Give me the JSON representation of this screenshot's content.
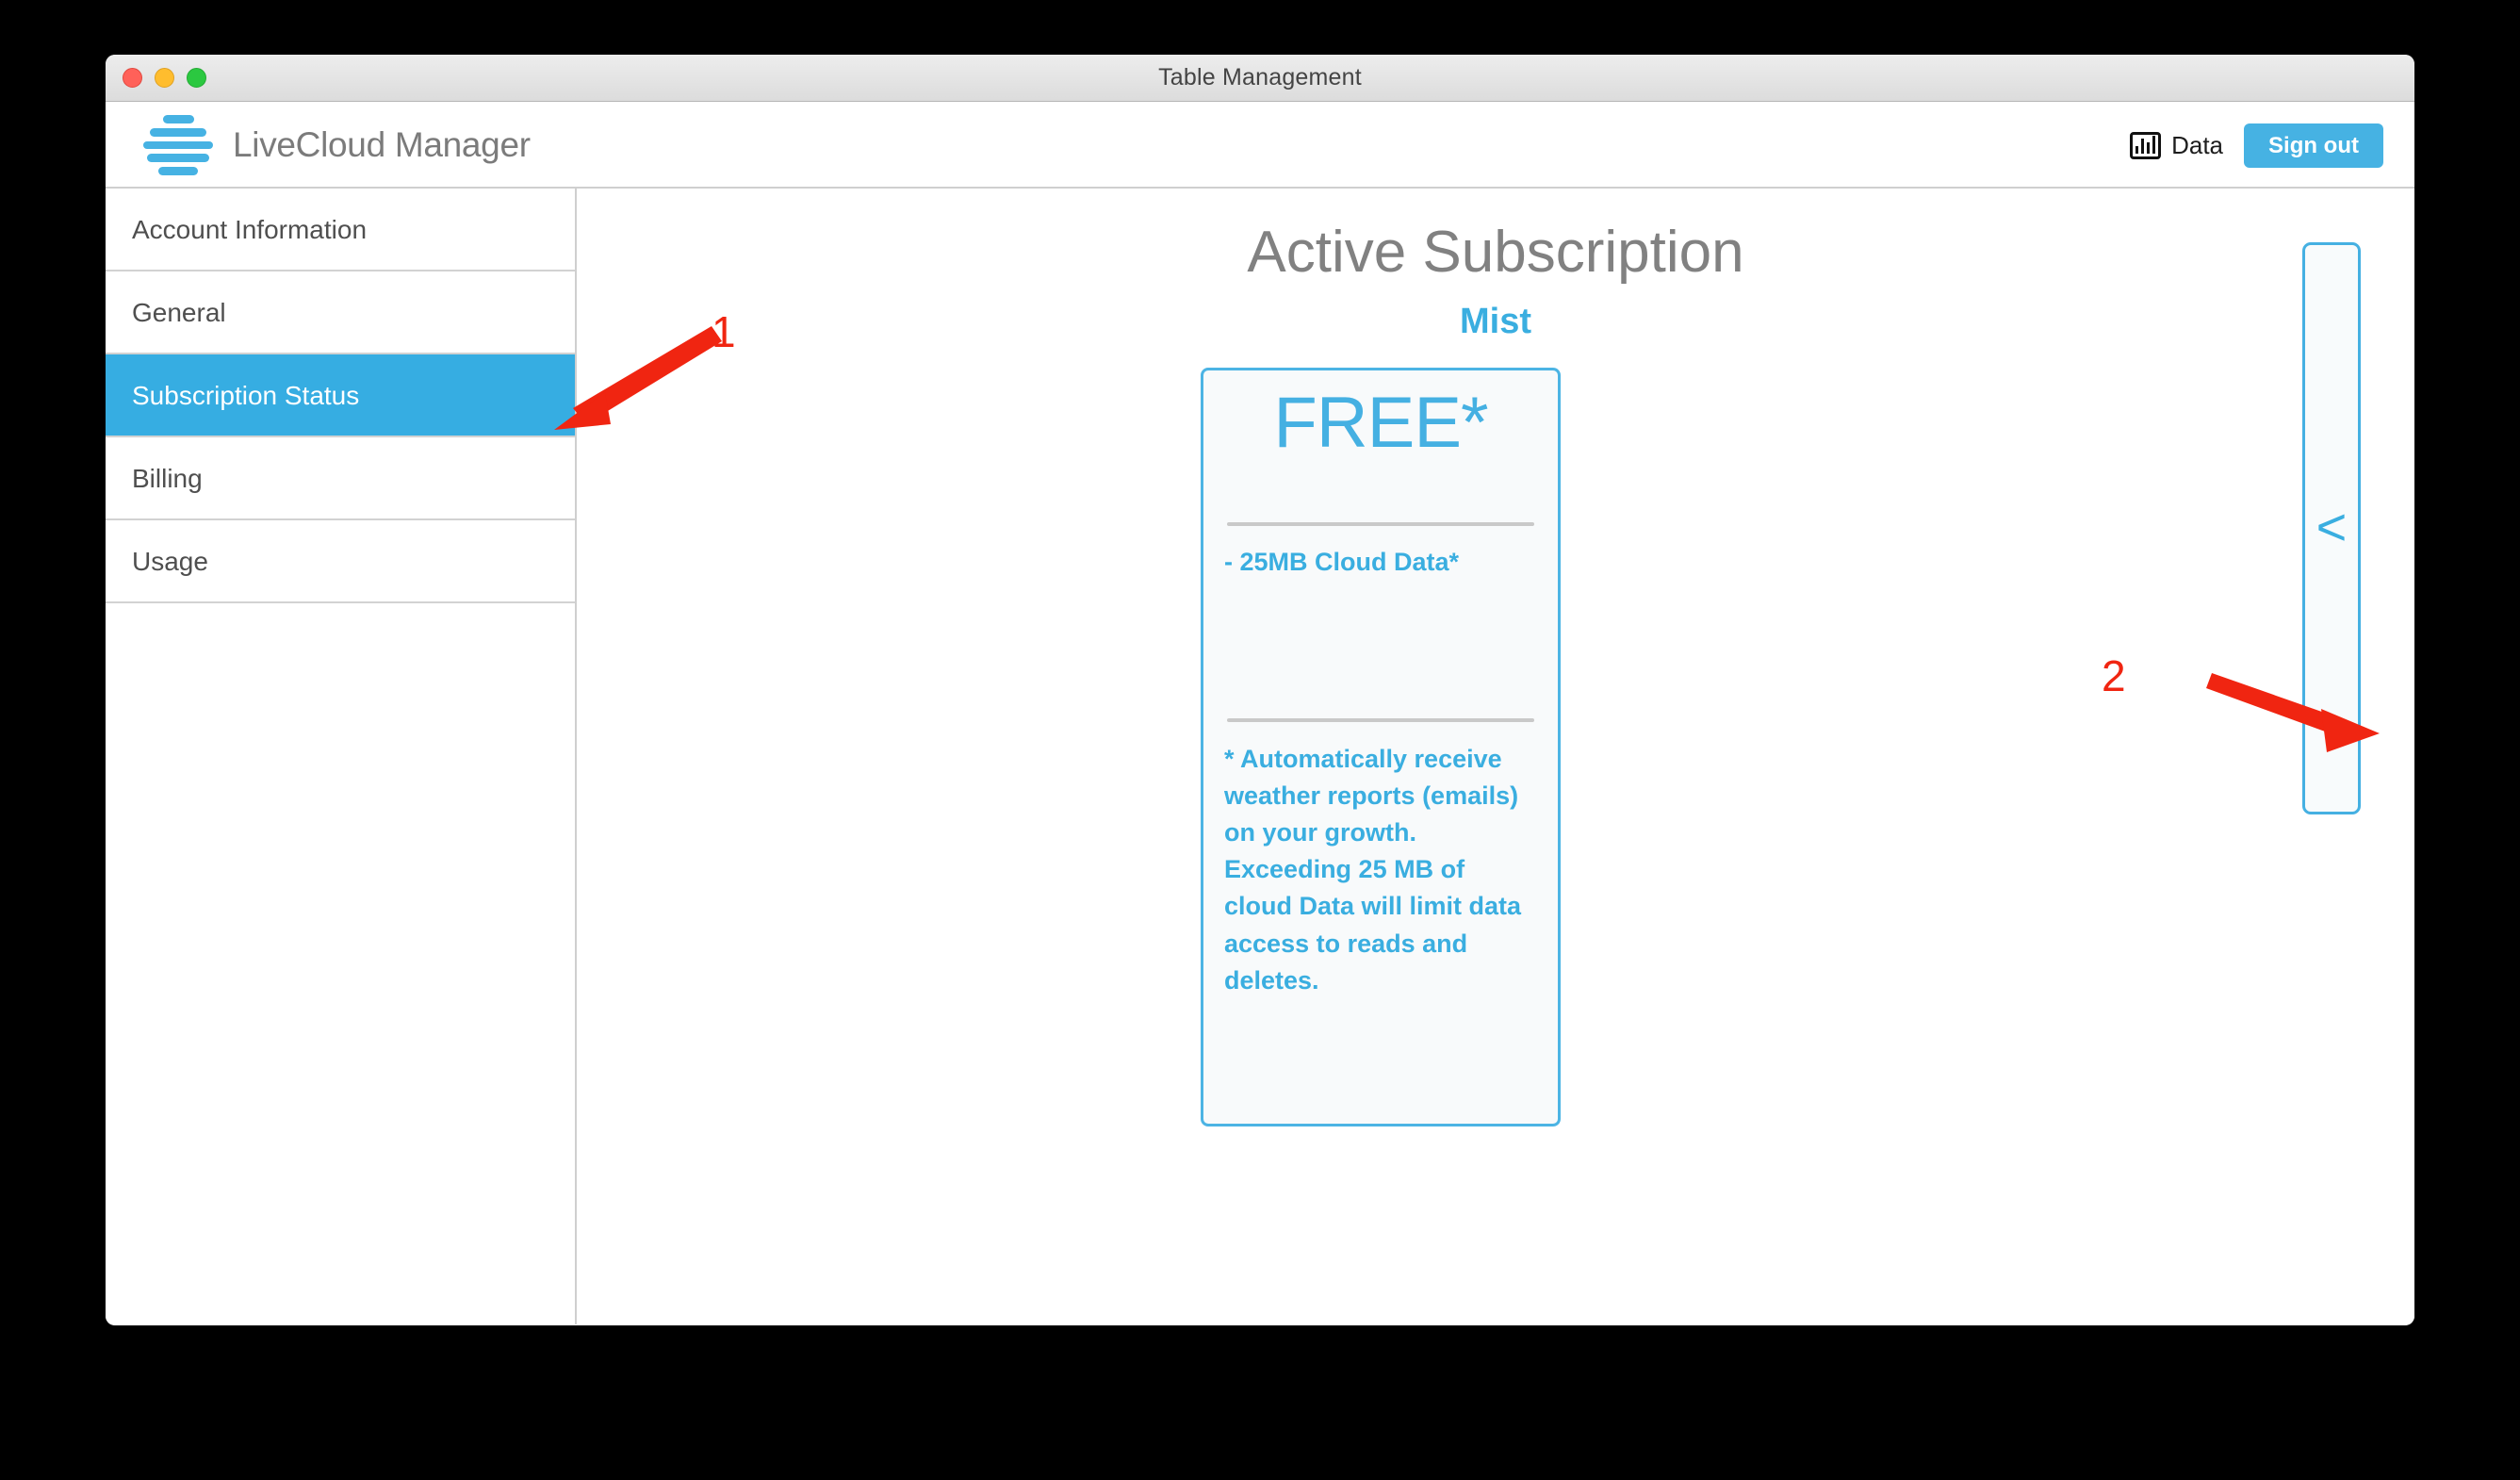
{
  "window": {
    "title": "Table Management",
    "traffic_lights": [
      "close-red",
      "minimize-yellow",
      "maximize-green"
    ]
  },
  "header": {
    "brand_name": "LiveCloud Manager",
    "logo_icon": "livecloud-stack-logo",
    "data_button": {
      "label": "Data",
      "icon": "bar-chart-icon"
    },
    "signout_button": {
      "label": "Sign out"
    }
  },
  "sidebar": {
    "items": [
      {
        "label": "Account Information",
        "selected": false
      },
      {
        "label": "General",
        "selected": false
      },
      {
        "label": "Subscription Status",
        "selected": true
      },
      {
        "label": "Billing",
        "selected": false
      },
      {
        "label": "Usage",
        "selected": false
      }
    ]
  },
  "main": {
    "page_title": "Active Subscription",
    "plan_name": "Mist",
    "card": {
      "price": "FREE*",
      "features": [
        "- 25MB Cloud Data*"
      ],
      "footnote": "* Automatically receive weather reports (emails) on your growth. Exceeding 25 MB of cloud Data will limit data access to reads and deletes."
    },
    "side_panel": {
      "collapse_icon": "<"
    }
  },
  "annotations": [
    {
      "number": "1",
      "target": "sidebar-item-subscription-status"
    },
    {
      "number": "2",
      "target": "side-collapse-panel"
    }
  ],
  "colors": {
    "accent_blue": "#36ade2",
    "brand_blue": "#46b2e3",
    "text_gray": "#818181",
    "annotation_red": "#f02511",
    "card_bg": "#f8fafb"
  }
}
